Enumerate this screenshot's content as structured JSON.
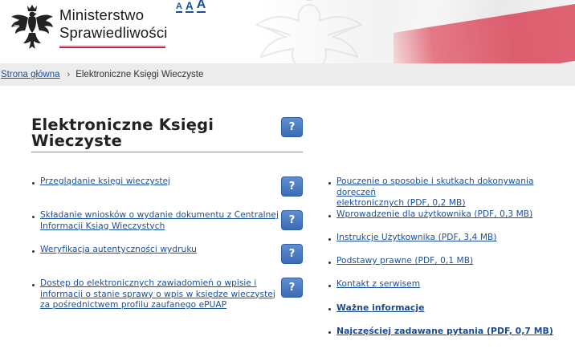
{
  "header": {
    "logo_line1": "Ministerstwo",
    "logo_line2": "Sprawiedliwości",
    "font_sizes": [
      "A",
      "A",
      "A"
    ]
  },
  "breadcrumb": {
    "home": "Strona główna",
    "separator": "›",
    "current": "Elektroniczne Księgi Wieczyste"
  },
  "main": {
    "title_line1": "Elektroniczne Księgi",
    "title_line2": "Wieczyste",
    "help_label": "?"
  },
  "left_links": [
    {
      "lines": [
        "Przeglądanie księgi wieczystej"
      ]
    },
    {
      "lines": [
        "Składanie wniosków o wydanie dokumentu z Centralnej",
        "Informacji Ksiąg Wieczystych"
      ]
    },
    {
      "lines": [
        "Weryfikacja autentyczności wydruku"
      ]
    },
    {
      "lines": [
        "Dostęp do elektronicznych zawiadomień o wpisie i",
        "informacji o stanie sprawy o wpis w księdze wieczystej",
        "za pośrednictwem profilu zaufanego ePUAP"
      ]
    }
  ],
  "right_links": [
    {
      "lines": [
        "Pouczenie o sposobie i skutkach dokonywania doręczeń",
        "elektronicznych (PDF, 0,2 MB)"
      ]
    },
    {
      "lines": [
        "Wprowadzenie dla użytkownika (PDF, 0,3 MB)"
      ]
    },
    {
      "lines": [
        "Instrukcje Użytkownika (PDF, 3,4 MB)"
      ]
    },
    {
      "lines": [
        "Podstawy prawne (PDF, 0,1 MB)"
      ]
    },
    {
      "lines": [
        "Kontakt z serwisem"
      ]
    },
    {
      "lines": [
        "Ważne informacje"
      ]
    },
    {
      "lines": [
        "Najczęściej zadawane pytania (PDF, 0,7 MB)"
      ]
    }
  ],
  "colors": {
    "link": "#1c4f9a",
    "help_button": "#3a6cb5",
    "brand_red": "#d4213d",
    "breadcrumb_bg": "#ececec"
  }
}
